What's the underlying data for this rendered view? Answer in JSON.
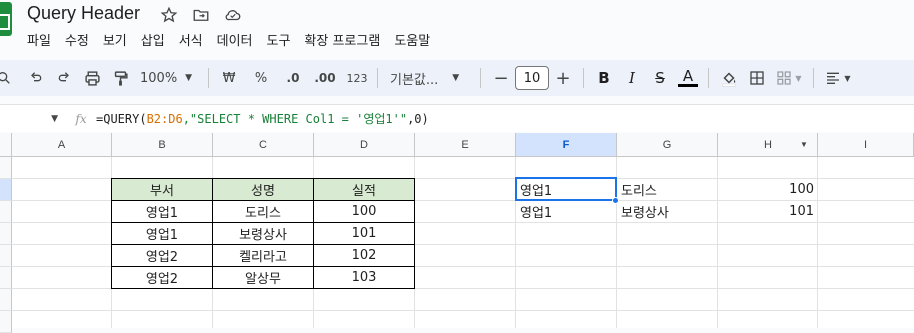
{
  "title": "Query Header",
  "menu": [
    "파일",
    "수정",
    "보기",
    "삽입",
    "서식",
    "데이터",
    "도구",
    "확장 프로그램",
    "도움말"
  ],
  "toolbar": {
    "zoom": "100%",
    "currency": "₩",
    "percent": "%",
    "dec_decrease": ".0",
    "dec_increase": ".00",
    "format_123": "123",
    "font": "기본값...",
    "font_size": "10",
    "bold": "B",
    "italic": "I",
    "strike": "S",
    "text_color": "A"
  },
  "formula_bar": {
    "fx": "fx",
    "prefix": "=QUERY(",
    "range": "B2:D6",
    "query": ",\"SELECT * WHERE Col1 = '영업1'\"",
    "suffix": ",0)"
  },
  "columns": [
    "A",
    "B",
    "C",
    "D",
    "E",
    "F",
    "G",
    "H",
    "I"
  ],
  "source_table": {
    "headers": [
      "부서",
      "성명",
      "실적"
    ],
    "rows": [
      [
        "영업1",
        "도리스",
        "100"
      ],
      [
        "영업1",
        "보령상사",
        "101"
      ],
      [
        "영업2",
        "켈리라고",
        "102"
      ],
      [
        "영업2",
        "알상무",
        "103"
      ]
    ]
  },
  "result": {
    "rows": [
      [
        "영업1",
        "도리스",
        "100"
      ],
      [
        "영업1",
        "보령상사",
        "101"
      ]
    ]
  },
  "colors": {
    "accent": "#1a73e8",
    "header_green": "#d9ead3",
    "sheets_green": "#1e8e3e"
  }
}
